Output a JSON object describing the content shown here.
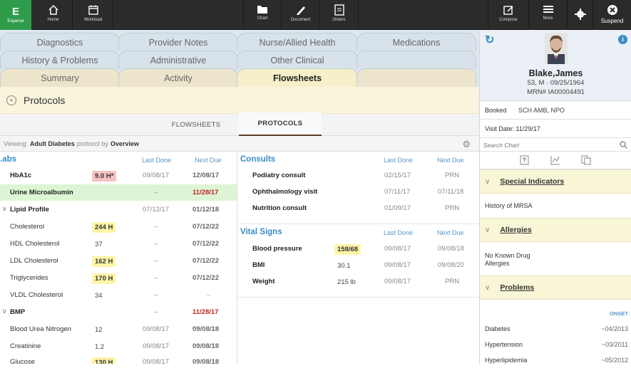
{
  "toolbar": {
    "brand": "Expanse",
    "home": "Home",
    "workload": "Workload",
    "chart": "Chart",
    "document": "Document",
    "orders": "Orders",
    "compose": "Compose",
    "more": "More",
    "suspend": "Suspend"
  },
  "tabs": {
    "diagnostics": "Diagnostics",
    "provider_notes": "Provider Notes",
    "nurse_allied": "Nurse/Allied Health",
    "medications": "Medications",
    "history_problems": "History & Problems",
    "administrative": "Administrative",
    "other_clinical": "Other Clinical",
    "summary": "Summary",
    "activity": "Activity",
    "flowsheets": "Flowsheets"
  },
  "page_title": "Protocols",
  "subtabs": {
    "flowsheets": "FLOWSHEETS",
    "protocols": "PROTOCOLS"
  },
  "viewing": {
    "prefix": "Viewing:",
    "protocol": "Adult Diabetes",
    "by": "protocol by",
    "view": "Overview"
  },
  "labs": {
    "title": ".abs",
    "col_last": "Last Done",
    "col_next": "Next Due",
    "rows": [
      {
        "name": "HbA1c",
        "value": "9.0 H*",
        "last": "09/08/17",
        "next": "12/08/17"
      },
      {
        "name": "Urine Microalbumin",
        "value": "",
        "last": "–",
        "next": "11/28/17"
      },
      {
        "name": "Lipid Profile",
        "value": "",
        "last": "07/12/17",
        "next": "01/12/18"
      },
      {
        "name": "Cholesterol",
        "value": "244 H",
        "last": "–",
        "next": "07/12/22"
      },
      {
        "name": "HDL Cholesterol",
        "value": "37",
        "last": "–",
        "next": "07/12/22"
      },
      {
        "name": "LDL Cholesterol",
        "value": "162 H",
        "last": "–",
        "next": "07/12/22"
      },
      {
        "name": "Triglycerides",
        "value": "170 H",
        "last": "–",
        "next": "07/12/22"
      },
      {
        "name": "VLDL Cholesterol",
        "value": "34",
        "last": "–",
        "next": "–"
      },
      {
        "name": "BMP",
        "value": "",
        "last": "–",
        "next": "11/28/17"
      },
      {
        "name": "Blood Urea Nitrogen",
        "value": "12",
        "last": "09/08/17",
        "next": "09/08/18"
      },
      {
        "name": "Creatinine",
        "value": "1.2",
        "last": "09/08/17",
        "next": "09/08/18"
      },
      {
        "name": "Glucose",
        "value": "130 H",
        "last": "09/08/17",
        "next": "09/08/18"
      }
    ]
  },
  "consults": {
    "title": "Consults",
    "col_last": "Last Done",
    "col_next": "Next Due",
    "rows": [
      {
        "name": "Podiatry consult",
        "last": "02/15/17",
        "next": "PRN"
      },
      {
        "name": "Ophthalmology visit",
        "last": "07/11/17",
        "next": "07/11/18"
      },
      {
        "name": "Nutrition consult",
        "last": "01/09/17",
        "next": "PRN"
      }
    ]
  },
  "vitals": {
    "title": "Vital Signs",
    "col_last": "Last Done",
    "col_next": "Next Due",
    "rows": [
      {
        "name": "Blood pressure",
        "value": "158/68",
        "last": "09/08/17",
        "next": "09/08/18"
      },
      {
        "name": "BMI",
        "value": "30.1",
        "last": "09/08/17",
        "next": "09/08/20"
      },
      {
        "name": "Weight",
        "value": "215 lb",
        "last": "09/08/17",
        "next": "PRN"
      }
    ]
  },
  "patient": {
    "name": "Blake,James",
    "demo": "53, M · 09/25/1964",
    "mrn": "MRN# IA00004491",
    "booked_label": "Booked",
    "booked_value": "SCH AMB, NPO",
    "visit_date": "Visit Date: 11/29/17"
  },
  "sidebar": {
    "search_placeholder": "Search Chart",
    "special_indicators": "Special Indicators",
    "special_indicators_value": "History of MRSA",
    "allergies": "Allergies",
    "allergies_value": "No Known Drug Allergies",
    "problems": "Problems",
    "onset": "ONSET",
    "problem_list": [
      {
        "name": "Diabetes",
        "date": "~04/2013"
      },
      {
        "name": "Hypertension",
        "date": "~03/2011"
      },
      {
        "name": "Hyperlipidemia",
        "date": "~05/2012"
      }
    ]
  },
  "colors": {
    "brand_green": "#2e9c4a",
    "accent_blue": "#3a8bc6",
    "flag_yellow": "#fff5a8",
    "flag_pink": "#f6c3c3",
    "highlight_green": "#ddf5d5",
    "overdue_red": "#c82020"
  }
}
